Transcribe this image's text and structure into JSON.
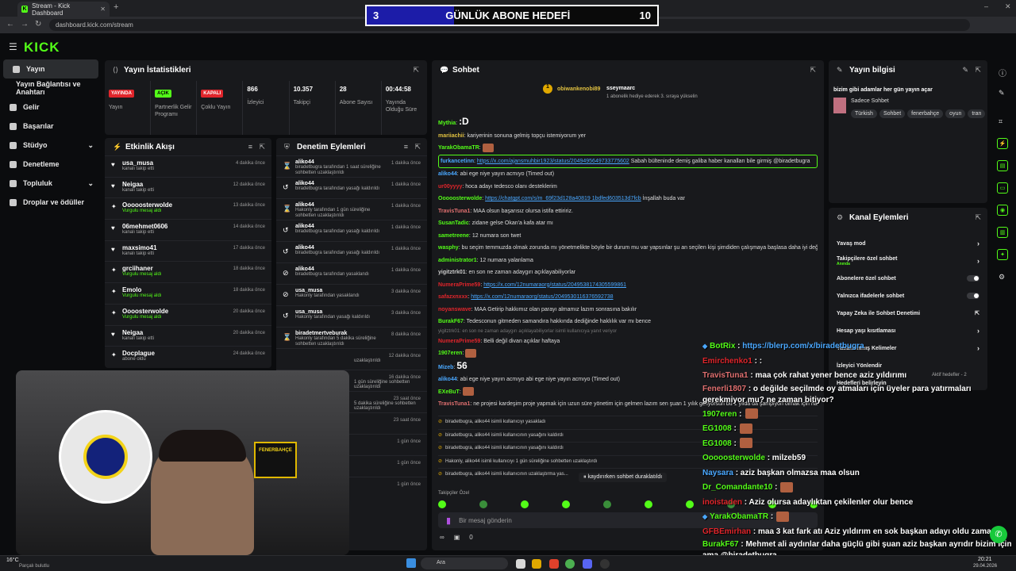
{
  "browser": {
    "tab_title": "Stream - Kick Dashboard",
    "url": "dashboard.kick.com/stream"
  },
  "goal": {
    "current": "3",
    "title": "GÜNLÜK ABONE HEDEFİ",
    "target": "10",
    "progress": 0.3
  },
  "sidebar": {
    "items": [
      {
        "label": "Yayın"
      },
      {
        "label": "Yayın Bağlantısı ve Anahtarı"
      },
      {
        "label": "Gelir"
      },
      {
        "label": "Başarılar"
      },
      {
        "label": "Stüdyo"
      },
      {
        "label": "Denetleme"
      },
      {
        "label": "Topluluk"
      },
      {
        "label": "Droplar ve ödüller"
      }
    ]
  },
  "stats": {
    "title": "Yayın İstatistikleri",
    "items": [
      {
        "badge": "YAYINDA",
        "label": "Yayın",
        "color": "#e0252b"
      },
      {
        "badge": "AÇIK",
        "label": "Partnerlik Gelir Programı",
        "color": "#53fc18"
      },
      {
        "badge": "KAPALI",
        "label": "Çoklu Yayın",
        "color": "#e0252b"
      },
      {
        "value": "866",
        "label": "İzleyici"
      },
      {
        "value": "10.357",
        "label": "Takipçi"
      },
      {
        "value": "28",
        "label": "Abone Sayısı"
      },
      {
        "value": "00:44:58",
        "label": "Yayında Olduğu Süre"
      }
    ]
  },
  "activity": {
    "title": "Etkinlik Akışı",
    "items": [
      {
        "name": "usa_musa",
        "sub": "kanalı takip etti",
        "time": "4 dakika önce"
      },
      {
        "name": "Neigaa",
        "sub": "kanalı takip etti",
        "time": "12 dakika önce"
      },
      {
        "name": "Ooooosterwolde",
        "sub": "Vurgulu mesaj aldı",
        "time": "13 dakika önce",
        "green": true
      },
      {
        "name": "06mehmet0606",
        "sub": "kanalı takip etti",
        "time": "14 dakika önce"
      },
      {
        "name": "maxsimo41",
        "sub": "kanalı takip etti",
        "time": "17 dakika önce"
      },
      {
        "name": "grciihaner",
        "sub": "Vurgulu mesaj aldı",
        "time": "18 dakika önce",
        "green": true
      },
      {
        "name": "Emolo",
        "sub": "Vurgulu mesaj aldı",
        "time": "18 dakika önce",
        "green": true
      },
      {
        "name": "Oooosterwolde",
        "sub": "Vurgulu mesaj aldı",
        "time": "20 dakika önce",
        "green": true
      },
      {
        "name": "Neigaa",
        "sub": "kanalı takip etti",
        "time": "20 dakika önce"
      },
      {
        "name": "Docplague",
        "sub": "abone oldu",
        "time": "24 dakika önce"
      }
    ]
  },
  "moderation": {
    "title": "Denetim Eylemleri",
    "items": [
      {
        "name": "aliko44",
        "sub": "biradetbugra tarafından 1 saat süreliğine sohbetten uzaklaştırıldı",
        "time": "1 dakika önce"
      },
      {
        "name": "aliko44",
        "sub": "biradetbugra tarafından yasağı kaldırıldı",
        "time": "1 dakika önce"
      },
      {
        "name": "aliko44",
        "sub": "Hakonly tarafından 1 gün süreliğine sohbetten uzaklaştırıldı",
        "time": "1 dakika önce"
      },
      {
        "name": "aliko44",
        "sub": "biradetbugra tarafından yasağı kaldırıldı",
        "time": "1 dakika önce"
      },
      {
        "name": "aliko44",
        "sub": "biradetbugra tarafından yasağı kaldırıldı",
        "time": "1 dakika önce"
      },
      {
        "name": "aliko44",
        "sub": "biradetbugra tarafından yasaklandı",
        "time": "1 dakika önce"
      },
      {
        "name": "usa_musa",
        "sub": "Hakonly tarafından yasaklandı",
        "time": "3 dakika önce"
      },
      {
        "name": "usa_musa",
        "sub": "Hakonly tarafından yasağı kaldırıldı",
        "time": "3 dakika önce"
      },
      {
        "name": "biradetmertveburak",
        "sub": "Hakonly tarafından 5 dakika süreliğine sohbetten uzaklaştırıldı",
        "time": "8 dakika önce"
      }
    ],
    "extra_times": [
      "12 dakika önce",
      "16 dakika önce",
      "23 saat önce",
      "23 saat önce",
      "1 gün önce",
      "1 gün önce",
      "1 gün önce"
    ],
    "extra_subs": [
      "uzaklaştırıldı",
      "1 gün süreliğine sohbetten uzaklaştırıldı",
      "5 dakika süreliğine sohbetten uzaklaştırıldı"
    ]
  },
  "chat": {
    "title": "Sohbet",
    "top1": {
      "name": "obiwankenobi89",
      "count": "1"
    },
    "top2": {
      "name": "sseymaarc",
      "count": "1",
      "note": "1 abonelik hediye ederek 3. sıraya yükselin"
    },
    "lines": [
      {
        "user": "Mythia",
        "color": "#53fc18",
        "text": ":D"
      },
      {
        "user": "mariiachii",
        "color": "#e0c040",
        "text": "kariyerinin sonuna gelmiş topçu istemiyorum yer"
      },
      {
        "user": "YarakObamaTR",
        "color": "#53fc18",
        "text": ""
      },
      {
        "user": "furkancetinn",
        "color": "#4aa8ff",
        "link": "https://x.com/ajansmuhbir1923/status/2049495649733775602",
        "text": "Sabah bülteninde demiş galiba haber kanalları bile girmiş @biradetbugra"
      },
      {
        "user": "aliko44",
        "color": "#4aa8ff",
        "text": "abi ege niye yayın acmıyo (Timed out)"
      },
      {
        "user": "ur00yyyy",
        "color": "#e0252b",
        "text": "hoca adayı tedesco olanı desteklerim"
      },
      {
        "user": "Ooooosterwolde",
        "color": "#53fc18",
        "link": "https://chatgpt.com/s/m_69f23d128a40819 1bdfed603513d7fcb",
        "text": "İnşallah buda var"
      },
      {
        "user": "TravisTuna1",
        "color": "#e07070",
        "text": "MAA olsun başarısız olursa istifa ettiririz."
      },
      {
        "user": "SusanTadic",
        "color": "#53fc18",
        "text": "zidane gelse Okan'a kafa atar mı"
      },
      {
        "user": "sametreene",
        "color": "#53fc18",
        "text": "12 numara son twet"
      },
      {
        "user": "wasphy",
        "color": "#53fc18",
        "text": "bu seçim temmuzda olmak zorunda mı yönetmelikte böyle bir durum mu var yapsınlar şu an seçilen kişi şimdiden çalışmaya başlasa daha iyi değil mi"
      },
      {
        "user": "administrator1",
        "color": "#53fc18",
        "text": "12 numara yalanlama"
      },
      {
        "user": "yigitztrk01",
        "color": "#cccccc",
        "text": "en son ne zaman adaygırı açıklayabiliyorlar"
      },
      {
        "user": "NumeraPrime59",
        "color": "#e0252b",
        "link": "https://x.com/12numaraorg/status/2049538174305599861",
        "text": ""
      },
      {
        "user": "safazxnxxx",
        "color": "#e0252b",
        "link": "https://x.com/12numaraorg/status/2049530116376592738",
        "text": ""
      },
      {
        "user": "noyanswave",
        "color": "#e0252b",
        "text": "MAA Getirip hakkımız olan parayı almamız lazım sonrasına bakılır"
      },
      {
        "user": "BurakF67",
        "color": "#53fc18",
        "text": "Tedesconun gitmeden samandıra hakkında dediğinde haklılık var mı bence"
      },
      {
        "user": "NumeraPrime59",
        "color": "#e0252b",
        "text": "Belli değil divan açıklar haftaya"
      },
      {
        "user": "1907eren",
        "color": "#53fc18",
        "text": ""
      },
      {
        "user": "Mizeb",
        "color": "#4aa8ff",
        "text": "56"
      },
      {
        "user": "aliko44",
        "color": "#4aa8ff",
        "text": "abi ege niye yayın acmıyo abi ege niye yayın acmıyo (Timed out)"
      },
      {
        "user": "EXeBuT",
        "color": "#53fc18",
        "text": ""
      },
      {
        "user": "TravisTuna1",
        "color": "#e07070",
        "text": "ne projesi kardeşim proje yapmak için uzun süre yönetim için gelmen lazım sen şuan 1 yılık geliyorsun bu 1 yılda da şampiyon olmak için harcıyacaksın hala proje diyonuz ya yazık"
      }
    ],
    "system": [
      "biradetbugra, aliko44 isimli kullanıcıyı yasakladı",
      "biradetbugra, aliko44 isimli kullanıcının yasağını kaldırdı",
      "biradetbugra, aliko44 isimli kullanıcının yasağını kaldırdı",
      "Hakonly, aliko44 isimli kullanıcıyı 1 gün süreliğine sohbetten uzaklaştırdı",
      "biradetbugra, aliko44 isimli kullanıcının uzaklaştırma yas..."
    ],
    "ghost_line": "yigitztrk01: en son ne zaman adaygırı açıklayabiliyorlar isimli kullanıcıya yanıt veriyor",
    "paused": "kaydırırken sohbet duraklatıldı",
    "follower_only": "Takipçiler Özel",
    "placeholder": "Bir mesaj gönderin",
    "footer_count": "0"
  },
  "stream_info": {
    "title": "Yayın bilgisi",
    "stream_title": "bizim gibi adamlar her gün yayın açar",
    "category": "Sadece Sohbet",
    "tags": [
      "Türkish",
      "Sohbet",
      "fenerbahçe",
      "oyun",
      "tran"
    ]
  },
  "channel_actions": {
    "title": "Kanal Eylemleri",
    "items": [
      {
        "label": "Yavaş mod",
        "control": "arrow"
      },
      {
        "label": "Takipçilere özel sohbet",
        "sub": "Anında",
        "control": "arrow"
      },
      {
        "label": "Abonelere özel sohbet",
        "control": "toggle"
      },
      {
        "label": "Yalnızca ifadelerle sohbet",
        "control": "toggle"
      },
      {
        "label": "Yapay Zeka ile Sohbet Denetimi",
        "control": "ext"
      },
      {
        "label": "Hesap yaşı kısıtlaması",
        "control": "arrow"
      },
      {
        "label": "Yasaklanmış Kelimeler",
        "control": "arrow"
      },
      {
        "label": "İzleyici Yönlendir",
        "control": ""
      },
      {
        "label": "Hedefleri belirleyin",
        "control": ""
      }
    ],
    "active_goals": "Aktif hedefler - 2"
  },
  "overlay_chat": [
    {
      "user": "BotRix",
      "color": "#53fc18",
      "text": "",
      "link": "https://blerp.com/x/biradetbugra"
    },
    {
      "user": "Emirchenko1",
      "color": "#e0252b",
      "text": ": :"
    },
    {
      "user": "TravisTuna1",
      "color": "#e07070",
      "text": ": maa çok rahat yener bence aziz yıldırımı"
    },
    {
      "user": "Fenerli1807",
      "color": "#e07070",
      "text": ": o değilde seçilmde oy atmaları için üyeler para yatırmaları gerekmiyor mu? ne zaman bitiyor?"
    },
    {
      "user": "1907eren",
      "color": "#53fc18",
      "text": ":"
    },
    {
      "user": "EG1008",
      "color": "#53fc18",
      "text": ":"
    },
    {
      "user": "EG1008",
      "color": "#53fc18",
      "text": ":"
    },
    {
      "user": "Ooooosterwolde",
      "color": "#53fc18",
      "text": ": milzeb59"
    },
    {
      "user": "Naysara",
      "color": "#4aa8ff",
      "text": ": aziz başkan olmazsa maa olsun"
    },
    {
      "user": "Dr_Comandante10",
      "color": "#53fc18",
      "text": ":"
    },
    {
      "user": "inoistaden",
      "color": "#e0252b",
      "text": ": Aziz olursa adaylıktan çekilenler olur bence"
    },
    {
      "user": "YarakObamaTR",
      "color": "#53fc18",
      "text": ":"
    },
    {
      "user": "GFBEmirhan",
      "color": "#e0252b",
      "text": ": maa 3 kat fark atı Aziz yıldırım en sok başkan adayı oldu zaman"
    },
    {
      "user": "BurakF67",
      "color": "#53fc18",
      "text": ": Mehmet ali aydınlar daha güçlü gibi şuan aziz başkan ayrıdır bizim için ama @biradetbugra"
    }
  ],
  "webcam": {
    "badge_text": "FENERBAHÇE",
    "club_text": "FENERBAHÇE SPOR KULÜBÜ 1907"
  },
  "taskbar": {
    "weather": "16°C",
    "weather_sub": "Parçalı bulutlu",
    "search": "Ara",
    "time": "20:21",
    "date": "29.04.2026"
  }
}
